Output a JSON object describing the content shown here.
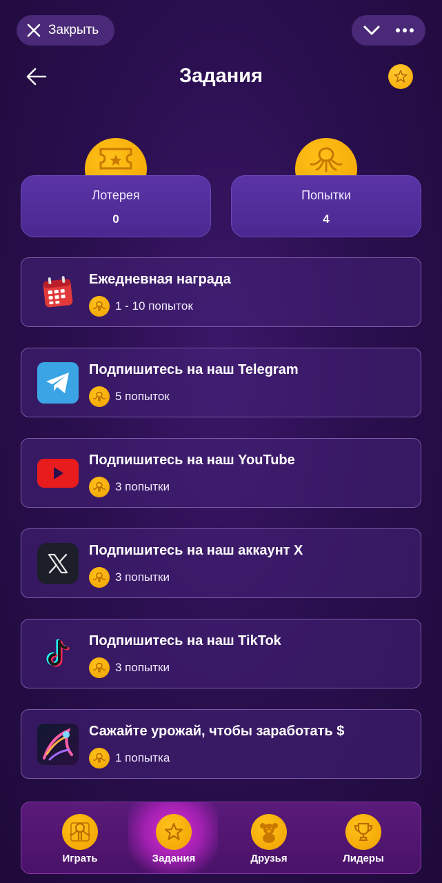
{
  "topbar": {
    "close_label": "Закрыть"
  },
  "header": {
    "title": "Задания"
  },
  "stats": [
    {
      "label": "Лотерея",
      "value": "0",
      "icon": "ticket-icon"
    },
    {
      "label": "Попытки",
      "value": "4",
      "icon": "octopus-icon"
    }
  ],
  "tasks": [
    {
      "title": "Ежедневная награда",
      "reward": "1 - 10 попыток",
      "icon": "calendar-icon"
    },
    {
      "title": "Подпишитесь на наш Telegram",
      "reward": "5 попыток",
      "icon": "telegram-icon"
    },
    {
      "title": "Подпишитесь на наш YouTube",
      "reward": "3 попытки",
      "icon": "youtube-icon"
    },
    {
      "title": "Подпишитесь на наш аккаунт X",
      "reward": "3 попытки",
      "icon": "x-icon"
    },
    {
      "title": "Подпишитесь на наш TikTok",
      "reward": "3 попытки",
      "icon": "tiktok-icon"
    },
    {
      "title": "Сажайте урожай, чтобы заработать $",
      "reward": "1 попытка",
      "icon": "game-art-icon"
    }
  ],
  "nav": [
    {
      "label": "Играть",
      "icon": "play-octopus-icon",
      "active": false
    },
    {
      "label": "Задания",
      "icon": "star-icon",
      "active": true
    },
    {
      "label": "Друзья",
      "icon": "teddy-bear-icon",
      "active": false
    },
    {
      "label": "Лидеры",
      "icon": "trophy-icon",
      "active": false
    }
  ],
  "colors": {
    "accent_gold": "#f5a500",
    "card_purple": "#4a2890",
    "background": "#2a0f4f",
    "active_nav_glow": "#e030d0"
  }
}
